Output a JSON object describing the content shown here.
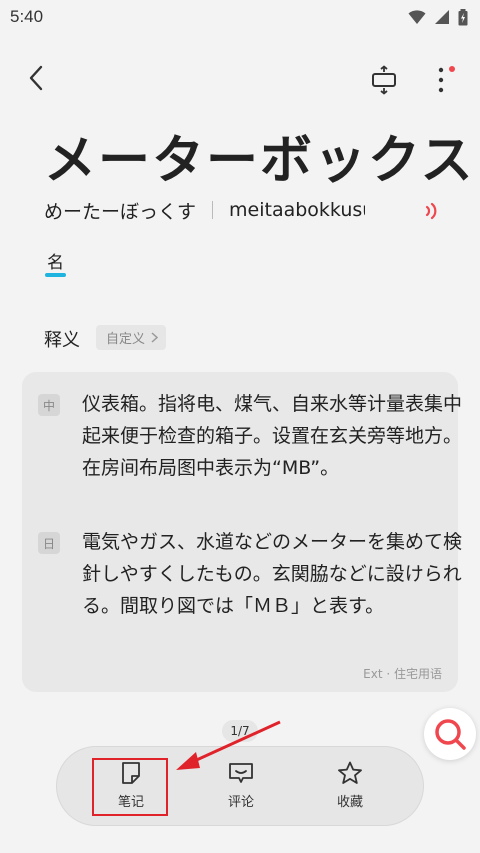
{
  "status_bar": {
    "time": "5:40"
  },
  "header": {
    "back_icon": "back-arrow-icon",
    "fit_icon": "fit-vertical-icon",
    "more_icon": "more-vertical-icon",
    "more_badge_color": "#f0474f"
  },
  "entry": {
    "word": "メーターボックス",
    "kana": "めーたーぼっくす",
    "romaji": "meitaabokkusu",
    "part_of_speech": "名"
  },
  "definition_section": {
    "label": "释义",
    "custom_button": "自定义",
    "zh_badge": "中",
    "zh_text": "仪表箱。指将电、煤气、自来水等计量表集中起来便于检查的箱子。设置在玄关旁等地方。在房间布局图中表示为“MB”。",
    "ja_badge": "日",
    "ja_text": "電気やガス、水道などのメーターを集めて検針しやすくしたもの。玄関脇などに設けられる。間取り図では「ＭＢ」と表す。",
    "source": "Ext · 住宅用语"
  },
  "pager": {
    "indicator": "1/7"
  },
  "bottom_bar": {
    "items": [
      {
        "label": "笔记",
        "icon": "note-icon"
      },
      {
        "label": "评论",
        "icon": "comment-icon"
      },
      {
        "label": "收藏",
        "icon": "star-icon"
      }
    ]
  },
  "colors": {
    "accent_red": "#f0474f",
    "annotation_red": "#e0232b",
    "pos_underline": "#1fb3e0"
  }
}
